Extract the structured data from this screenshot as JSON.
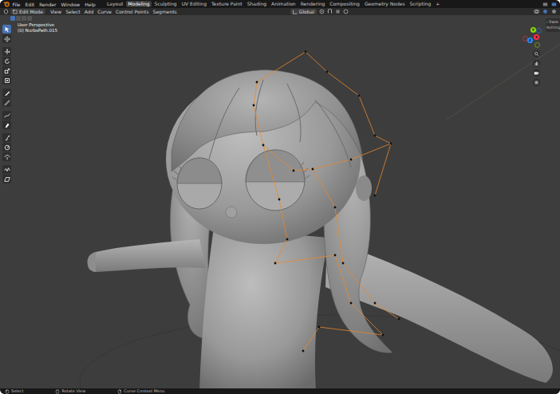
{
  "app_menu": [
    "File",
    "Edit",
    "Render",
    "Window",
    "Help"
  ],
  "workspaces": [
    {
      "label": "Layout",
      "selected": false
    },
    {
      "label": "Modeling",
      "selected": true
    },
    {
      "label": "Sculpting",
      "selected": false
    },
    {
      "label": "UV Editing",
      "selected": false
    },
    {
      "label": "Texture Paint",
      "selected": false
    },
    {
      "label": "Shading",
      "selected": false
    },
    {
      "label": "Animation",
      "selected": false
    },
    {
      "label": "Rendering",
      "selected": false
    },
    {
      "label": "Compositing",
      "selected": false
    },
    {
      "label": "Geometry Nodes",
      "selected": false
    },
    {
      "label": "Scripting",
      "selected": false
    }
  ],
  "add_workspace": "+",
  "header": {
    "mode": "Edit Mode",
    "menus": [
      "View",
      "Select",
      "Add",
      "Curve",
      "Control Points",
      "Segments"
    ],
    "orientation": "Global"
  },
  "select_modes": [
    {
      "selected": true
    },
    {
      "selected": false
    },
    {
      "selected": false
    },
    {
      "selected": false
    }
  ],
  "viewport": {
    "view": "User Perspective",
    "object": "(0) NurbsPath.015"
  },
  "tools": [
    {
      "selected": true
    },
    {
      "selected": false
    },
    {
      "selected": false
    },
    {
      "selected": false
    },
    {
      "selected": false
    },
    {
      "selected": false
    },
    {
      "selected": false
    },
    {
      "selected": false
    },
    {
      "selected": false
    },
    {
      "selected": false
    },
    {
      "selected": false
    },
    {
      "selected": false
    },
    {
      "selected": false
    },
    {
      "selected": false
    },
    {
      "selected": false
    }
  ],
  "gizmo": [
    {
      "axis": "X",
      "color": "#ff3352"
    },
    {
      "axis": "Y",
      "color": "#8bdc00"
    },
    {
      "axis": "Z",
      "color": "#2890ff"
    }
  ],
  "sidebar": {
    "icon": "›",
    "header": "Trans",
    "text": "Nothing"
  },
  "status_bar": [
    "Select",
    "Rotate View",
    "Curve Context Menu"
  ]
}
